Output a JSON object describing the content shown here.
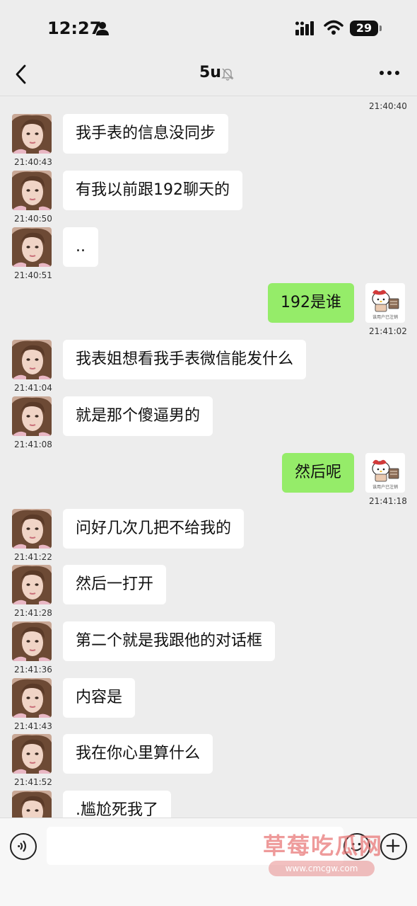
{
  "status_bar": {
    "time": "12:27",
    "battery": "29"
  },
  "nav": {
    "title": "5u"
  },
  "top_timestamp": "21:40:40",
  "messages": [
    {
      "side": "left",
      "text": "我手表的信息没同步",
      "time": "21:40:43"
    },
    {
      "side": "left",
      "text": "有我以前跟192聊天的",
      "time": "21:40:50"
    },
    {
      "side": "left",
      "text": "..",
      "time": "21:40:51"
    },
    {
      "side": "right",
      "text": "192是谁",
      "time": "21:41:02"
    },
    {
      "side": "left",
      "text": "我表姐想看我手表微信能发什么",
      "time": "21:41:04"
    },
    {
      "side": "left",
      "text": "就是那个傻逼男的",
      "time": "21:41:08"
    },
    {
      "side": "right",
      "text": "然后呢",
      "time": "21:41:18"
    },
    {
      "side": "left",
      "text": "问好几次几把不给我的",
      "time": "21:41:22"
    },
    {
      "side": "left",
      "text": "然后一打开",
      "time": "21:41:28"
    },
    {
      "side": "left",
      "text": "第二个就是我跟他的对话框",
      "time": "21:41:36"
    },
    {
      "side": "left",
      "text": "内容是",
      "time": "21:41:43"
    },
    {
      "side": "left",
      "text": "我在你心里算什么",
      "time": "21:41:52"
    },
    {
      "side": "left",
      "text": ".尴尬死我了",
      "time": ""
    }
  ],
  "self_avatar_caption": "该用户已注销",
  "watermark": {
    "text": "草莓吃瓜网",
    "url": "www.cmcgw.com"
  },
  "icons": {
    "back": "back-arrow-icon",
    "mute": "mute-bell-icon",
    "more": "more-dots-icon",
    "voice": "voice-icon",
    "emoji": "emoji-icon",
    "plus": "plus-icon"
  },
  "colors": {
    "background": "#ededed",
    "bubble_self": "#95ec69",
    "bubble_other": "#ffffff"
  }
}
